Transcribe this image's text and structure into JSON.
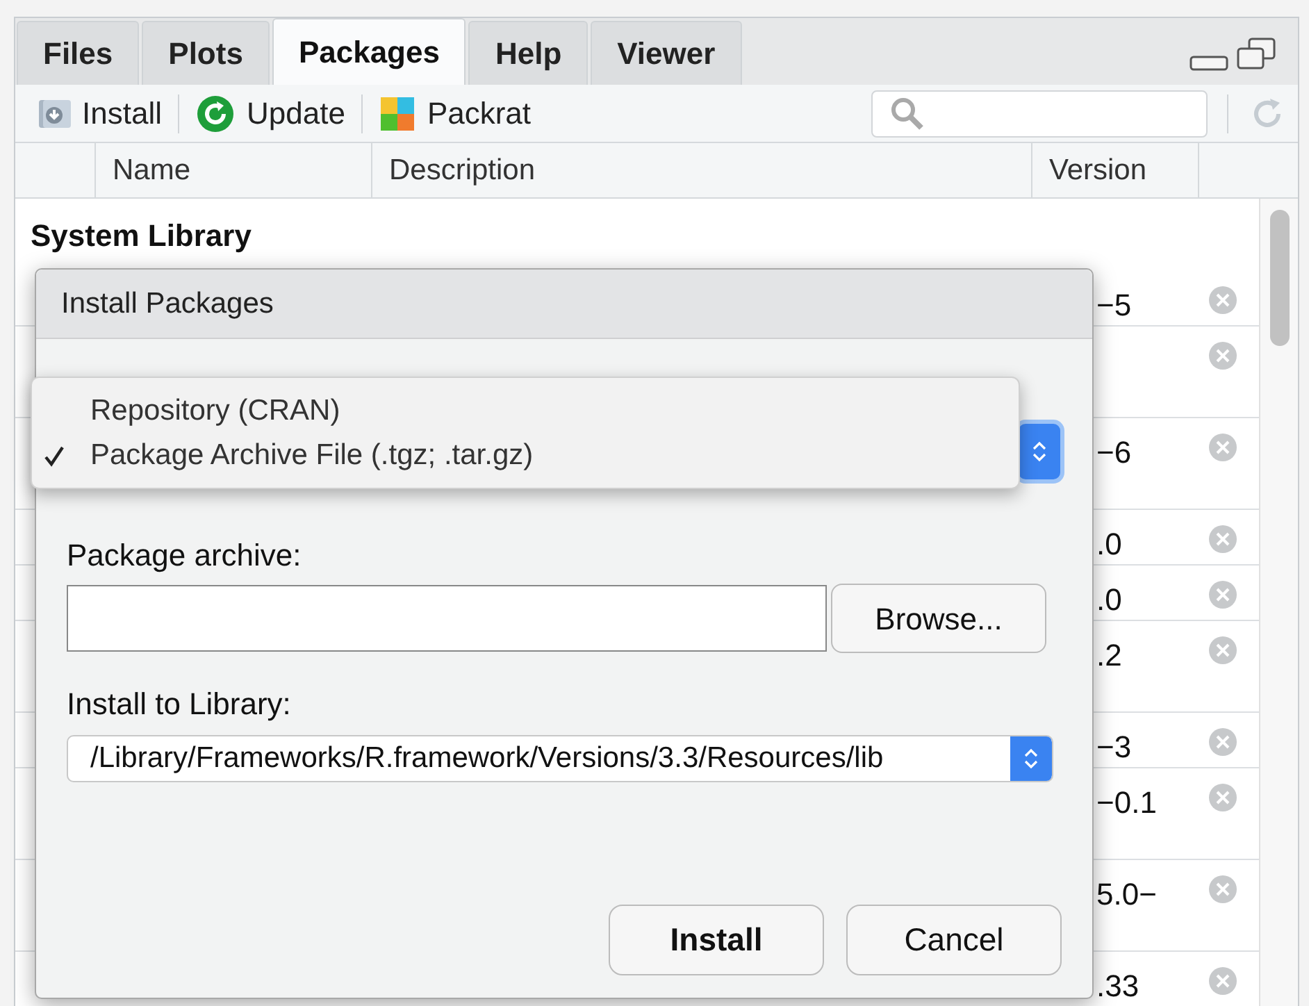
{
  "tabs": [
    {
      "label": "Files",
      "selected": false
    },
    {
      "label": "Plots",
      "selected": false
    },
    {
      "label": "Packages",
      "selected": true
    },
    {
      "label": "Help",
      "selected": false
    },
    {
      "label": "Viewer",
      "selected": false
    }
  ],
  "toolbar": [
    {
      "kind": "install",
      "label": "Install"
    },
    {
      "kind": "update",
      "label": "Update"
    },
    {
      "kind": "packrat",
      "label": "Packrat"
    }
  ],
  "columns": [
    "Name",
    "Description",
    "Version"
  ],
  "section": "System Library",
  "rows": [
    {
      "version": "−5",
      "tall": false
    },
    {
      "tall": true
    },
    {
      "version": "−6",
      "tall": true
    },
    {
      "version": ".0",
      "tall": false
    },
    {
      "version": ".0",
      "tall": false
    },
    {
      "version": ".2",
      "tall": true
    },
    {
      "version": "−3",
      "tall": false
    },
    {
      "version": "−0.1",
      "tall": true
    },
    {
      "version": "5.0−",
      "tall": true
    },
    {
      "version": ".33",
      "tall": false
    }
  ],
  "dialog": {
    "title": "Install Packages",
    "install_from": {
      "options": [
        {
          "label": "Repository (CRAN)",
          "selected": false
        },
        {
          "label": "Package Archive File (.tgz; .tar.gz)",
          "selected": true
        }
      ]
    },
    "archive_label": "Package archive:",
    "browse": "Browse...",
    "library_label": "Install to Library:",
    "library_value": "/Library/Frameworks/R.framework/Versions/3.3/Resources/lib",
    "buttons": [
      "Install",
      "Cancel"
    ]
  }
}
